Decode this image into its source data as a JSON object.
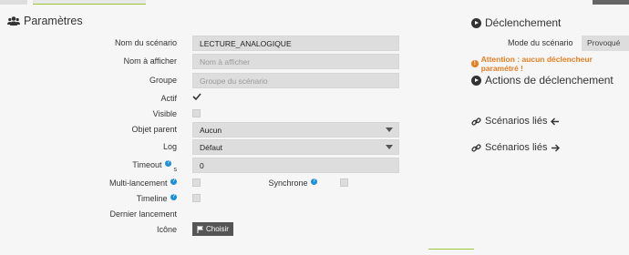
{
  "section": {
    "title": "Paramètres",
    "icon": "users-icon"
  },
  "fields": {
    "nom_scenario": {
      "label": "Nom du scénario",
      "value": "LECTURE_ANALOGIQUE"
    },
    "nom_afficher": {
      "label": "Nom à afficher",
      "placeholder": "Nom à afficher"
    },
    "groupe": {
      "label": "Groupe",
      "placeholder": "Groupe du scénario"
    },
    "actif": {
      "label": "Actif",
      "checked": true
    },
    "visible": {
      "label": "Visible",
      "checked": false
    },
    "objet_parent": {
      "label": "Objet parent",
      "value": "Aucun"
    },
    "log": {
      "label": "Log",
      "value": "Défaut"
    },
    "timeout": {
      "label": "Timeout",
      "suffix": "s",
      "value": "0"
    },
    "multi_lancement": {
      "label": "Multi-lancement",
      "checked": false
    },
    "synchrone": {
      "label": "Synchrone",
      "checked": false
    },
    "timeline": {
      "label": "Timeline",
      "checked": false
    },
    "dernier_lancement": {
      "label": "Dernier lancement"
    },
    "icone": {
      "label": "Icône",
      "button": "Choisir"
    }
  },
  "right": {
    "declenchement": "Déclenchement",
    "mode_label": "Mode du scénario",
    "mode_value": "Provoqué",
    "warning": "Attention : aucun déclencheur paramétré !",
    "actions": "Actions de déclenchement",
    "scenarios_lies_1": "Scénarios liés",
    "scenarios_lies_2": "Scénarios liés"
  },
  "colors": {
    "warning": "#e67e22",
    "help": "#1e90d8",
    "accent": "#9bc53d"
  }
}
